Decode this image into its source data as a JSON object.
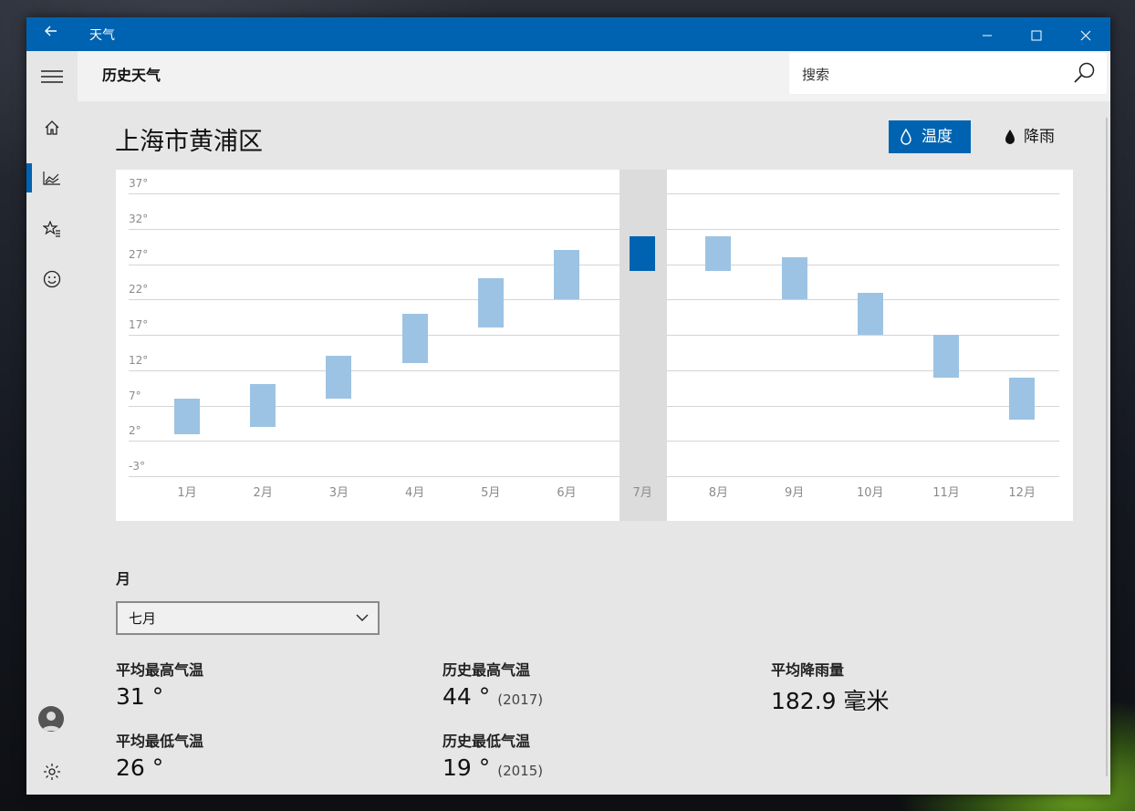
{
  "window": {
    "title": "天气",
    "back_icon": "back-arrow-icon",
    "controls": [
      "minimize-icon",
      "maximize-icon",
      "close-icon"
    ]
  },
  "header": {
    "title": "历史天气",
    "search_placeholder": "搜索"
  },
  "nav": {
    "items": [
      {
        "icon": "menu-icon"
      },
      {
        "icon": "home-icon"
      },
      {
        "icon": "history-chart-icon",
        "selected": true
      },
      {
        "icon": "favorites-icon"
      },
      {
        "icon": "smiley-icon"
      }
    ],
    "bottom": [
      {
        "icon": "account-icon"
      },
      {
        "icon": "settings-icon"
      }
    ]
  },
  "location": "上海市黄浦区",
  "toggles": {
    "temperature": "温度",
    "rain": "降雨"
  },
  "colors": {
    "accent": "#0063b1",
    "bar": "#9cc3e3",
    "bar_selected": "#0063b1"
  },
  "chart_data": {
    "type": "bar",
    "categories": [
      "1月",
      "2月",
      "3月",
      "4月",
      "5月",
      "6月",
      "7月",
      "8月",
      "9月",
      "10月",
      "11月",
      "12月"
    ],
    "y_ticks": [
      "37°",
      "32°",
      "27°",
      "22°",
      "17°",
      "12°",
      "7°",
      "2°",
      "-3°"
    ],
    "ylim": [
      -3,
      37
    ],
    "series": [
      {
        "low": [
          3,
          4,
          8,
          13,
          18,
          22,
          26,
          26,
          22,
          17,
          11,
          5
        ],
        "high": [
          8,
          10,
          14,
          20,
          25,
          29,
          31,
          31,
          28,
          23,
          17,
          11
        ]
      }
    ],
    "selected_index": 6
  },
  "month_select": {
    "label": "月",
    "value": "七月"
  },
  "stats": {
    "avg_high": {
      "label": "平均最高气温",
      "value": "31 °"
    },
    "record_high": {
      "label": "历史最高气温",
      "value": "44 °",
      "year": "(2017)"
    },
    "avg_rain": {
      "label": "平均降雨量",
      "value": "182.9 毫米"
    },
    "avg_low": {
      "label": "平均最低气温",
      "value": "26 °"
    },
    "record_low": {
      "label": "历史最低气温",
      "value": "19 °",
      "year": "(2015)"
    }
  }
}
